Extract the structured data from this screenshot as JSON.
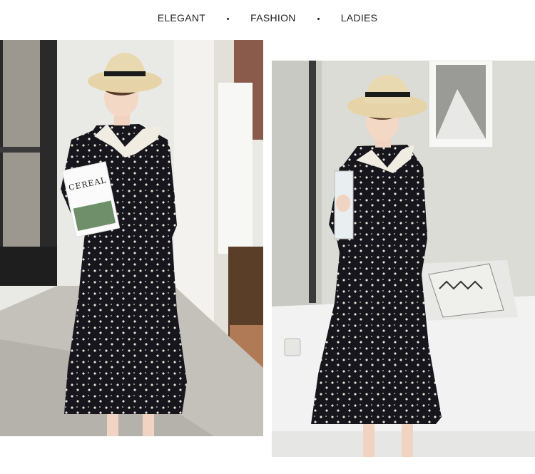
{
  "header": {
    "words": [
      "ELEGANT",
      "FASHION",
      "LADIES"
    ]
  },
  "photos": {
    "left": {
      "book_title": "CEREAL"
    }
  },
  "colors": {
    "dress": "#16161c",
    "hat": "#e6d4a8",
    "hat_band": "#1a1a1a",
    "wall": "#dcdcd6",
    "bed": "#f2f2f2"
  }
}
